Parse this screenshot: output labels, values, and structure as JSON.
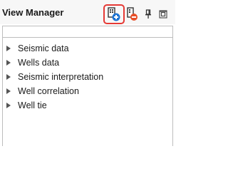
{
  "panel": {
    "title": "View Manager"
  },
  "toolbar": {
    "buttons": [
      {
        "name": "add-view-button",
        "icon": "add-view-icon"
      },
      {
        "name": "remove-view-button",
        "icon": "remove-view-icon"
      },
      {
        "name": "pin-button",
        "icon": "pin-icon"
      },
      {
        "name": "float-button",
        "icon": "float-window-icon"
      }
    ],
    "highlight_color": "#e53935",
    "accent_blue": "#1e73d2",
    "accent_red": "#e8502a"
  },
  "search": {
    "value": ""
  },
  "tree": {
    "items": [
      {
        "label": "Seismic data"
      },
      {
        "label": "Wells data"
      },
      {
        "label": "Seismic interpretation"
      },
      {
        "label": "Well correlation"
      },
      {
        "label": "Well tie"
      }
    ]
  }
}
